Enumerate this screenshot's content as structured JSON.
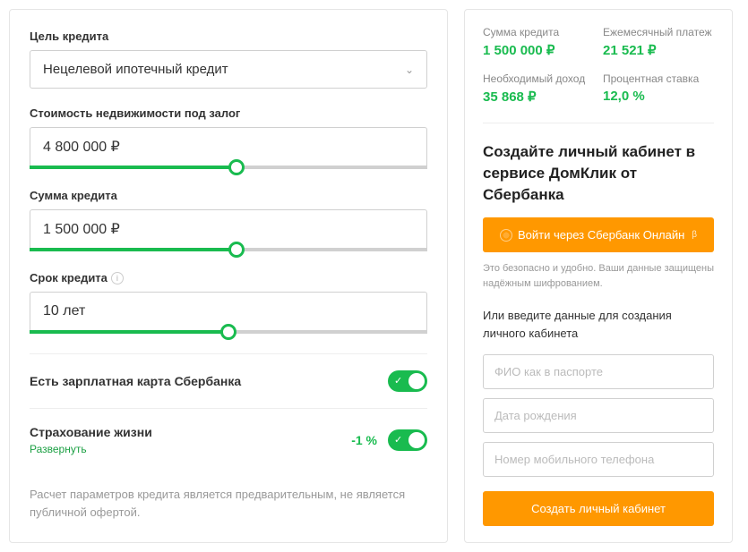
{
  "left": {
    "purpose": {
      "label": "Цель кредита",
      "value": "Нецелевой ипотечный кредит"
    },
    "collateral": {
      "label": "Стоимость недвижимости под залог",
      "value": "4 800 000 ₽",
      "fill": 52
    },
    "amount": {
      "label": "Сумма кредита",
      "value": "1 500 000 ₽",
      "fill": 52
    },
    "term": {
      "label": "Срок кредита",
      "value": "10 лет",
      "fill": 50
    },
    "salary_card": {
      "label": "Есть зарплатная карта Сбербанка"
    },
    "insurance": {
      "label": "Страхование жизни",
      "expand": "Развернуть",
      "discount": "-1 %"
    },
    "disclaimer": "Расчет параметров кредита является предварительным, не является публичной офертой."
  },
  "right": {
    "stats": {
      "sum_label": "Сумма кредита",
      "sum_value": "1 500 000 ₽",
      "monthly_label": "Ежемесячный платеж",
      "monthly_value": "21 521 ₽",
      "income_label": "Необходимый доход",
      "income_value": "35 868 ₽",
      "rate_label": "Процентная ставка",
      "rate_value": "12,0 %"
    },
    "heading": "Создайте личный кабинет в сервисе ДомКлик от Сбербанка",
    "sber_btn": "Войти через Сбербанк Онлайн",
    "beta": "β",
    "hint": "Это безопасно и удобно. Ваши данные защищены надёжным шифрованием.",
    "sub_heading": "Или введите данные для создания личного кабинета",
    "placeholders": {
      "name": "ФИО как в паспорте",
      "dob": "Дата рождения",
      "phone": "Номер мобильного телефона"
    },
    "submit": "Создать личный кабинет"
  }
}
